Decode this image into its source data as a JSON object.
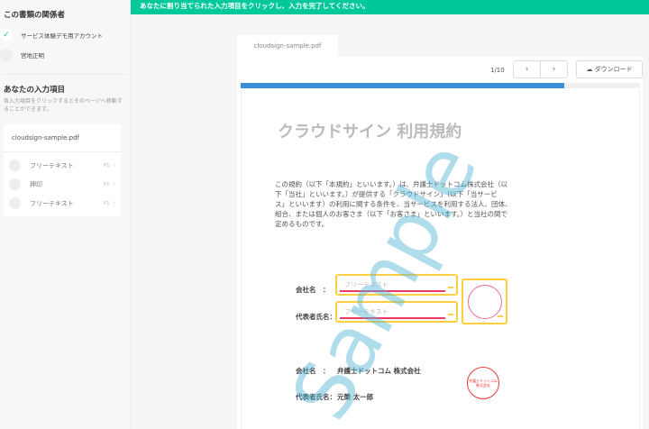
{
  "sidebar": {
    "parties_title": "この書類の関係者",
    "parties": [
      {
        "name": "サービス体験デモ用アカウント",
        "done": true
      },
      {
        "name": "宮地正明",
        "done": false
      }
    ],
    "inputs_title": "あなたの入力項目",
    "inputs_desc": "各入力項目をクリックするとそのページへ移動することができます。",
    "file_name": "cloudsign-sample.pdf",
    "items": [
      {
        "label": "フリーテキスト",
        "page": "P1"
      },
      {
        "label": "押印",
        "page": "P1"
      },
      {
        "label": "フリーテキスト",
        "page": "P1"
      }
    ]
  },
  "banner": {
    "text": "あなたに割り当てられた入力項目をクリックし、入力を完了してください。",
    "color": "#00c89a"
  },
  "viewer": {
    "tab": "cloudsign-sample.pdf",
    "page_indicator": "1/10",
    "prev_icon": "chevron-left",
    "next_icon": "chevron-right",
    "download_label": "ダウンロード",
    "progress_percent": 81,
    "progress_color": "#3a8fd6"
  },
  "document": {
    "title": "クラウドサイン 利用規約",
    "paragraph_lines": [
      "この規約（以下「本規約」といいます。）は、弁護士ドットコム株式会社（以",
      "下「当社」といいます。）が提供する「クラウドサイン」（以下「当サービ",
      "ス」といいます）の利用に関する条件を、当サービスを利用する法人、団体、",
      "組合、または個人のお客さま（以下「お客さま」といいます。）と当社の間で",
      "定めるものです。"
    ],
    "company_label": "会社名　：",
    "rep_label": "代表者氏名：",
    "field_placeholder": "フリーテキスト",
    "company_value": "弁護士ドットコム 株式会社",
    "rep_value": "元榮 太一郎",
    "stamp_text": "弁護士ドットコム株式会社",
    "watermark": "Sample"
  }
}
